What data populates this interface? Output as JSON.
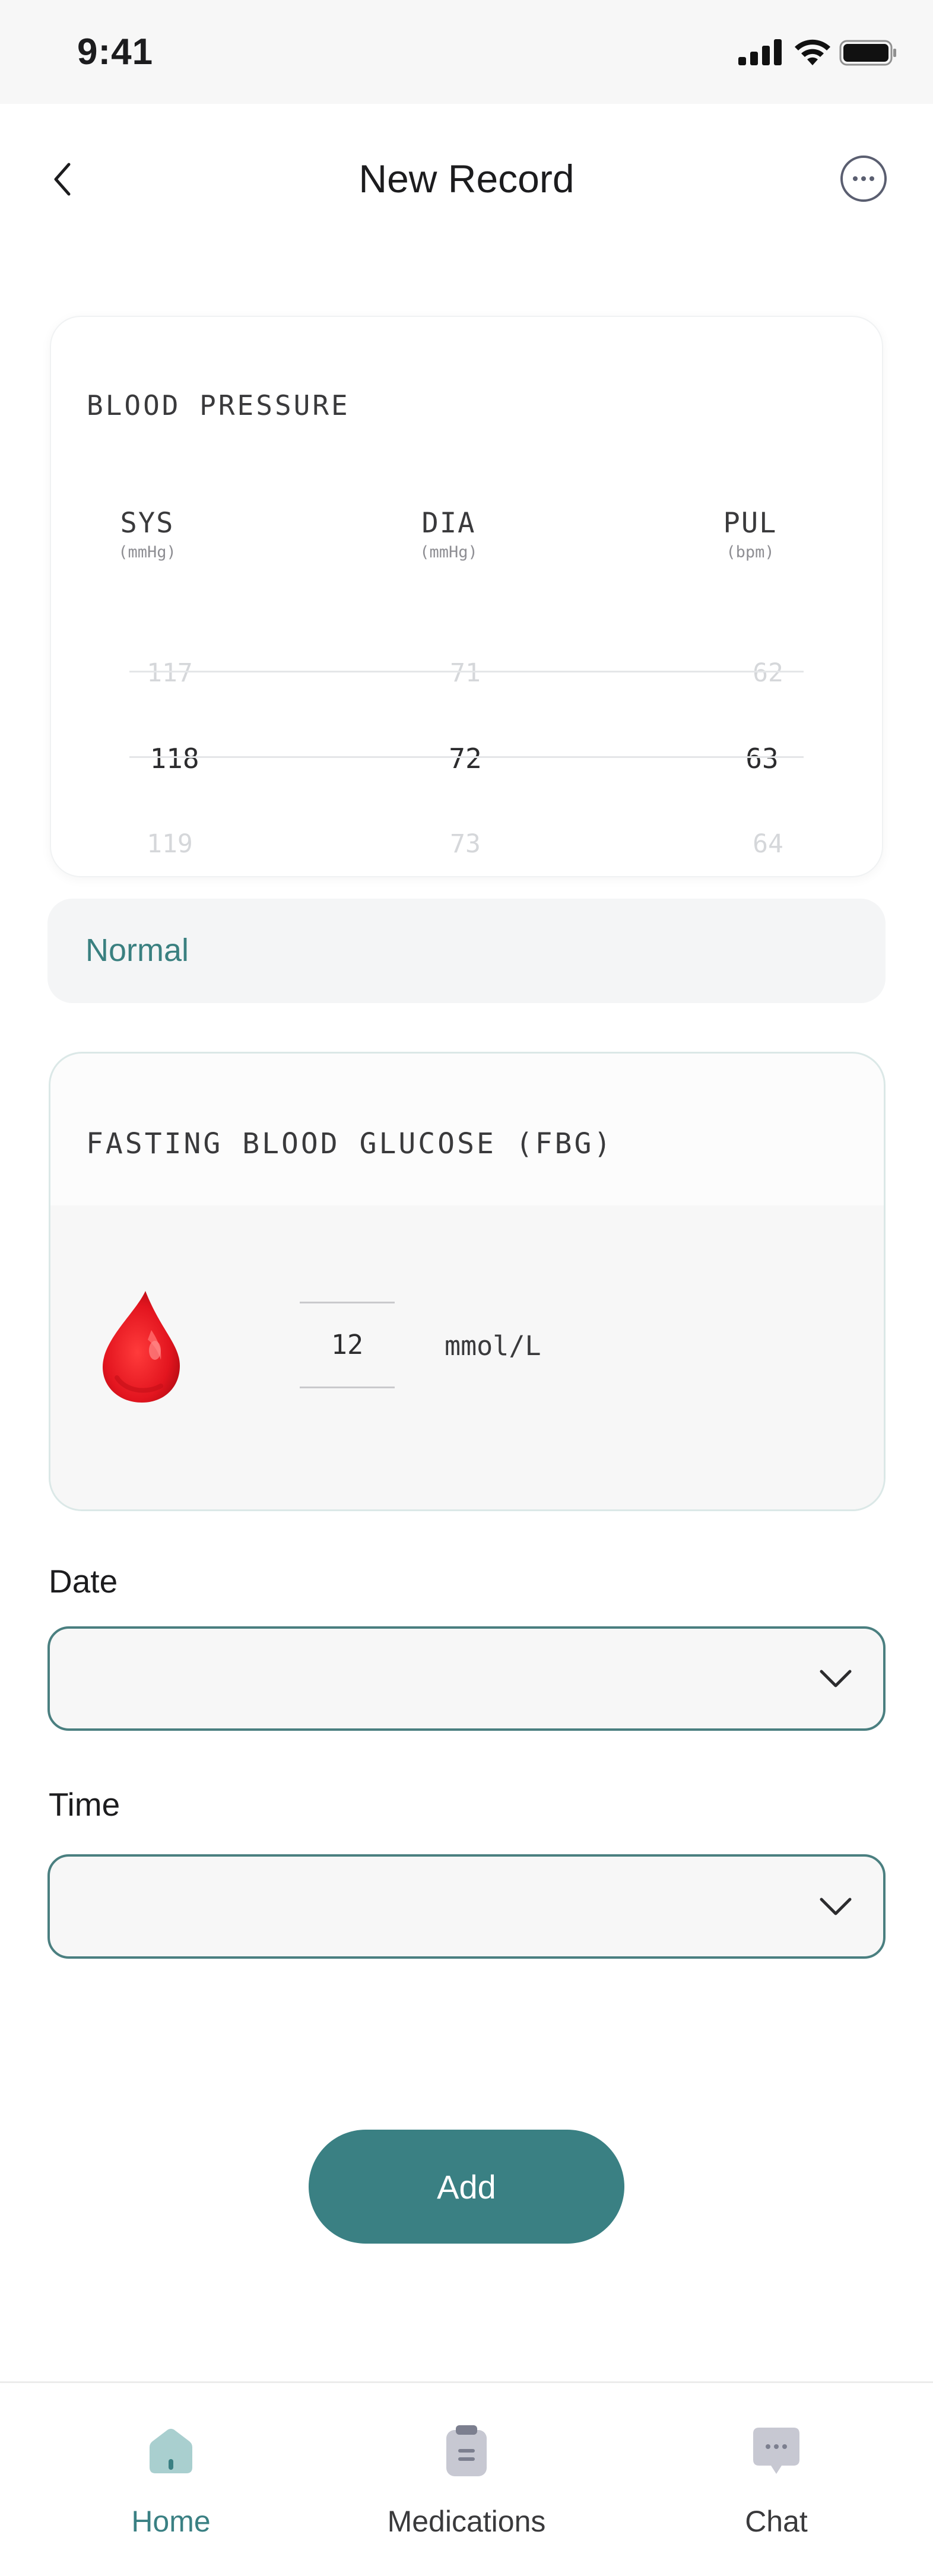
{
  "status_bar": {
    "time": "9:41"
  },
  "header": {
    "title": "New Record"
  },
  "blood_pressure": {
    "title": "BLOOD PRESSURE",
    "columns": [
      {
        "label": "SYS",
        "unit": "(mmHg)"
      },
      {
        "label": "DIA",
        "unit": "(mmHg)"
      },
      {
        "label": "PUL",
        "unit": "(bpm)"
      }
    ],
    "rows": [
      [
        "117",
        "71",
        "62"
      ],
      [
        "118",
        "72",
        "63"
      ],
      [
        "119",
        "73",
        "64"
      ]
    ],
    "status": "Normal"
  },
  "glucose": {
    "title": "FASTING BLOOD GLUCOSE (FBG)",
    "value": "12",
    "unit": "mmol/L"
  },
  "date_field": {
    "label": "Date",
    "value": ""
  },
  "time_field": {
    "label": "Time",
    "value": ""
  },
  "add_button": {
    "label": "Add"
  },
  "tabbar": {
    "items": [
      {
        "label": "Home",
        "icon": "home-icon",
        "active": true
      },
      {
        "label": "Medications",
        "icon": "clipboard-icon",
        "active": false
      },
      {
        "label": "Chat",
        "icon": "chat-bubble-icon",
        "active": false
      }
    ]
  },
  "colors": {
    "accent": "#3a8083",
    "status_text": "#3a8080",
    "drop_red": "#e3151f"
  }
}
